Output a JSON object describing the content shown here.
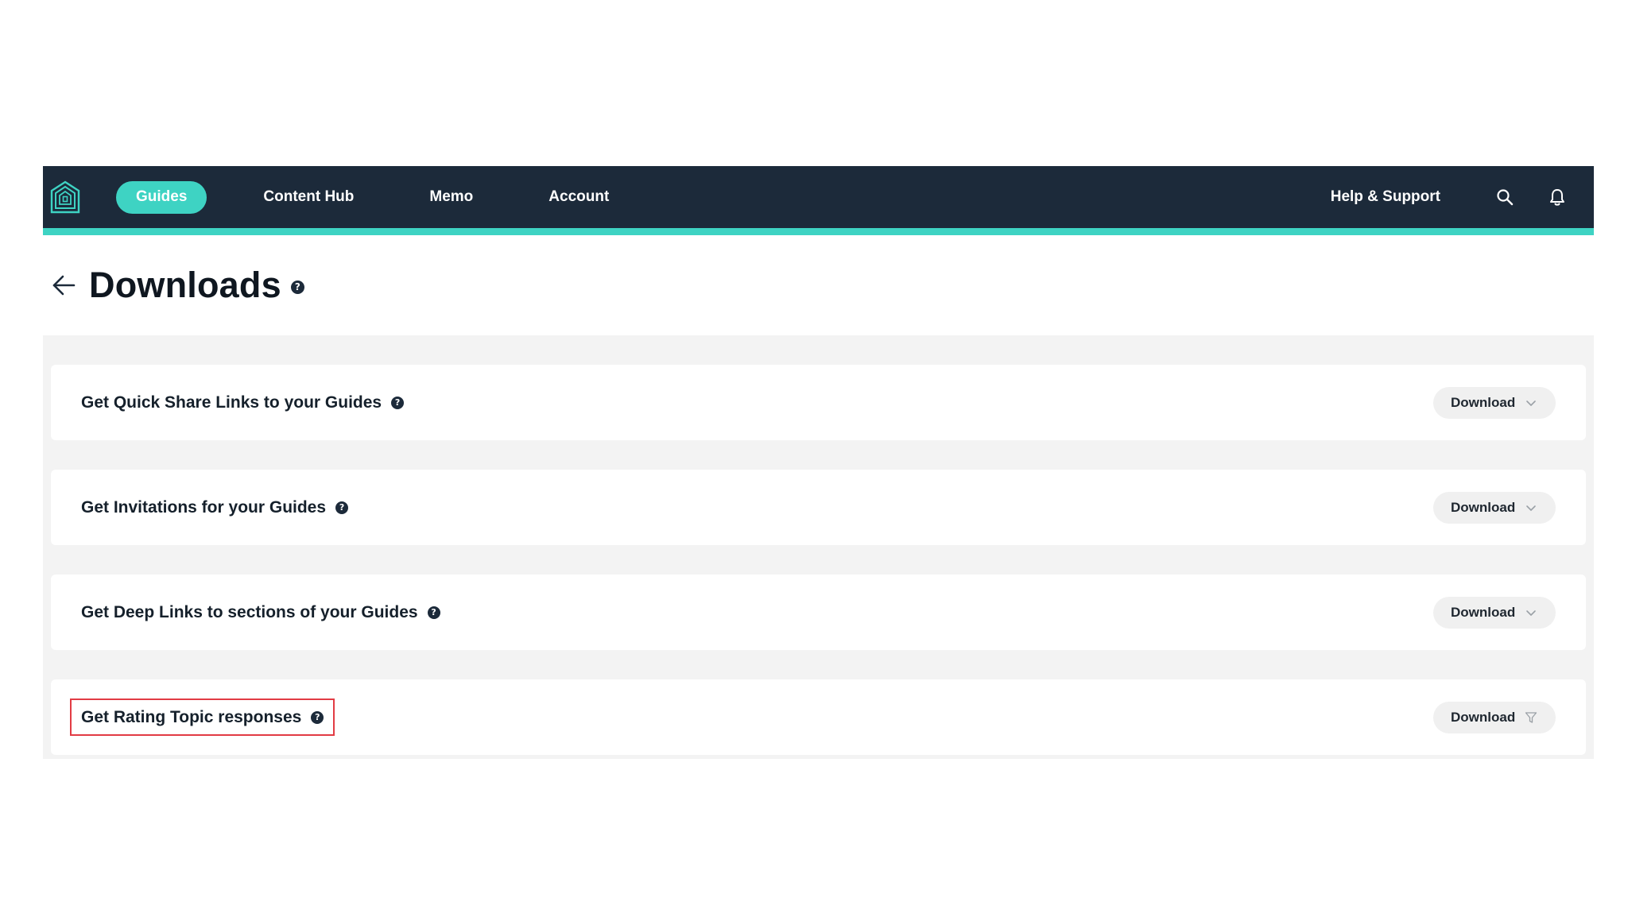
{
  "nav": {
    "items": [
      {
        "label": "Guides",
        "active": true
      },
      {
        "label": "Content Hub"
      },
      {
        "label": "Memo"
      },
      {
        "label": "Account"
      }
    ],
    "help_label": "Help & Support",
    "icons": [
      "logo-icon",
      "search-icon",
      "bell-icon"
    ]
  },
  "header": {
    "title": "Downloads",
    "help_glyph": "?"
  },
  "cards": [
    {
      "label": "Get Quick Share Links to your Guides",
      "help_glyph": "?",
      "button": "Download",
      "button_icon": "chevron-down-icon"
    },
    {
      "label": "Get Invitations for your Guides",
      "help_glyph": "?",
      "button": "Download",
      "button_icon": "chevron-down-icon"
    },
    {
      "label": "Get Deep Links to sections of your Guides",
      "help_glyph": "?",
      "button": "Download",
      "button_icon": "chevron-down-icon"
    },
    {
      "label": "Get Rating Topic responses",
      "help_glyph": "?",
      "button": "Download",
      "button_icon": "filter-icon",
      "highlighted": true
    }
  ],
  "colors": {
    "nav_bg": "#1c2a3a",
    "accent": "#3ed3c3",
    "panel_bg": "#f3f3f3",
    "highlight": "#e23b44"
  }
}
